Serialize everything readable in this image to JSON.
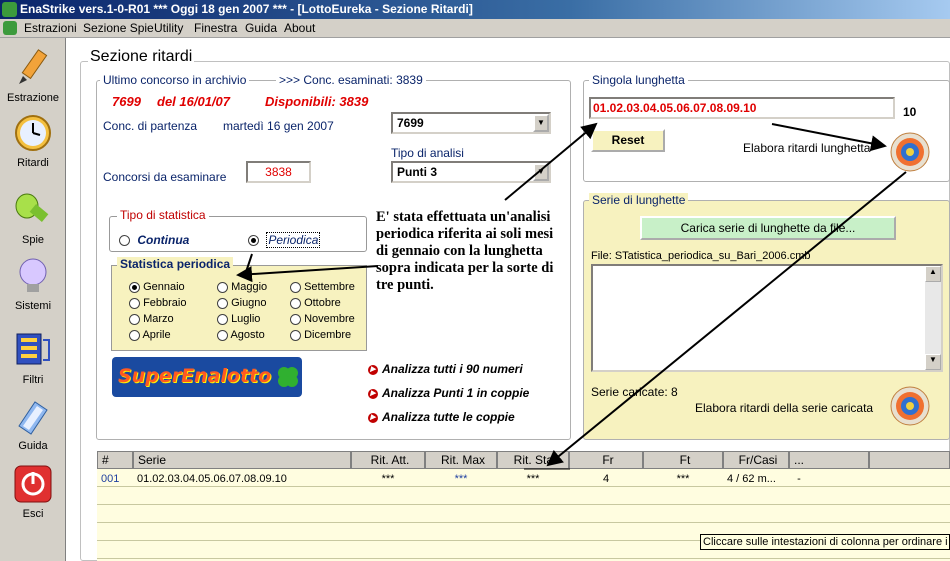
{
  "window": {
    "title": "EnaStrike vers.1-0-R01  ***  Oggi 18 gen 2007  ***  - [LottoEureka - Sezione Ritardi]"
  },
  "menu": [
    "Estrazioni",
    "Sezione Spie",
    "Utility",
    "Finestra",
    "Guida",
    "About"
  ],
  "sidebar": [
    {
      "label": "Estrazione",
      "icon": "pencil-icon"
    },
    {
      "label": "Ritardi",
      "icon": "clock-icon"
    },
    {
      "label": "Spie",
      "icon": "flashlight-icon"
    },
    {
      "label": "Sistemi",
      "icon": "lightbulb-icon"
    },
    {
      "label": "Filtri",
      "icon": "filter-icon"
    },
    {
      "label": "Guida",
      "icon": "book-icon"
    },
    {
      "label": "Esci",
      "icon": "power-icon"
    }
  ],
  "section_title": "Sezione ritardi",
  "archive": {
    "legend": "Ultimo concorso in archivio",
    "examined": ">>> Conc. esaminati: 3839",
    "last_number": "7699",
    "last_date": "del 16/01/07",
    "available": "Disponibili: 3839",
    "start_label": "Conc. di partenza",
    "start_date": "martedì 16 gen 2007",
    "start_value": "7699",
    "count_label": "Concorsi da esaminare",
    "count_value": "3838",
    "analysis_label": "Tipo di analisi",
    "analysis_value": "Punti 3"
  },
  "stat_type": {
    "legend": "Tipo di statistica",
    "continua": "Continua",
    "periodica": "Periodica",
    "selected": "Periodica"
  },
  "periodic": {
    "legend": "Statistica periodica",
    "months": [
      "Gennaio",
      "Febbraio",
      "Marzo",
      "Aprile",
      "Maggio",
      "Giugno",
      "Luglio",
      "Agosto",
      "Settembre",
      "Ottobre",
      "Novembre",
      "Dicembre"
    ],
    "selected": "Gennaio"
  },
  "logo": {
    "text": "SuperEnalotto"
  },
  "annotation": "E' stata effettuata un'analisi periodica riferita ai soli mesi di gennaio con la lunghetta sopra indicata per la sorte di tre punti.",
  "actions": [
    "Analizza tutti i 90 numeri",
    "Analizza Punti 1 in coppie",
    "Analizza tutte le coppie"
  ],
  "single": {
    "legend": "Singola lunghetta",
    "value": "01.02.03.04.05.06.07.08.09.10",
    "count": "10",
    "reset": "Reset",
    "process": "Elabora ritardi lunghetta"
  },
  "series": {
    "legend": "Serie di lunghette",
    "load": "Carica serie di lunghette da file...",
    "file": "File: STatistica_periodica_su_Bari_2006.cmb",
    "loaded": "Serie caricate: 8",
    "process": "Elabora ritardi della serie caricata"
  },
  "grid": {
    "headers": [
      "#",
      "Serie",
      "Rit. Att.",
      "Rit. Max",
      "Rit. Stat",
      "Fr",
      "Ft",
      "Fr/Casi",
      "..."
    ],
    "rows": [
      [
        "001",
        "01.02.03.04.05.06.07.08.09.10",
        "***",
        "***",
        "***",
        "4",
        "***",
        "4 / 62 m...",
        "-"
      ]
    ],
    "tooltip": "Cliccare sulle intestazioni di colonna per ordinare i da"
  }
}
